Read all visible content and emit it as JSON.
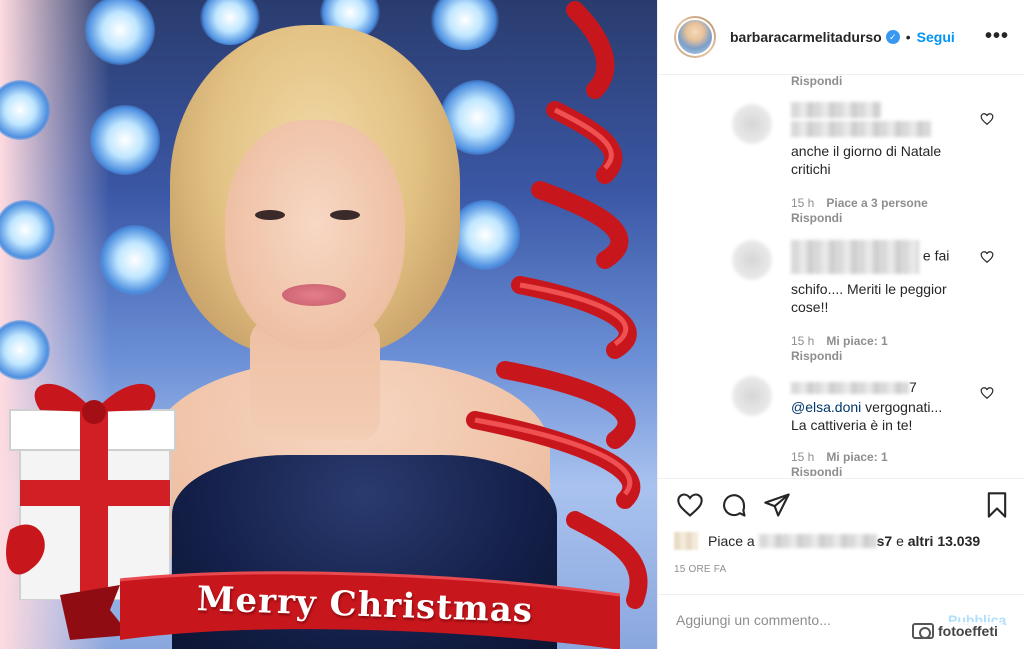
{
  "post": {
    "image_banner_text": "Merry Christmas"
  },
  "header": {
    "username": "barbaracarmelitadurso",
    "verified_icon": "verified-badge-icon",
    "follow_label": "Segui",
    "more_icon": "more-options-icon"
  },
  "comments": {
    "top_reply_label": "Rispondi",
    "items": [
      {
        "username_visible": "",
        "text": "anche il giorno di Natale critichi",
        "time": "15 h",
        "likes": "Piace a 3 persone",
        "reply_label": "Rispondi"
      },
      {
        "username_visible": "",
        "text_suffix": "e fai",
        "text": "schifo.... Meriti le peggior cose!!",
        "time": "15 h",
        "likes": "Mi piace: 1",
        "reply_label": "Rispondi"
      },
      {
        "username_visible": "7",
        "mention": "@elsa.doni",
        "text_after_mention": " vergognati...",
        "text": "La cattiveria è in te!",
        "time": "15 h",
        "likes": "Mi piace: 1",
        "reply_label": "Rispondi"
      }
    ]
  },
  "actions": {
    "like_icon": "heart-icon",
    "comment_icon": "comment-icon",
    "share_icon": "share-icon",
    "save_icon": "bookmark-icon"
  },
  "likes": {
    "prefix": "Piace a",
    "user_suffix": "s7",
    "and": "e",
    "others": "altri 13.039"
  },
  "timestamp": "15 ORE FA",
  "add_comment": {
    "placeholder": "Aggiungi un commento...",
    "publish_label": "Pubblica"
  },
  "watermark": "fotoeffeti",
  "colors": {
    "accent": "#0095f6",
    "muted": "#8e8e8e",
    "text": "#262626",
    "publish_disabled": "#b2dffc"
  }
}
